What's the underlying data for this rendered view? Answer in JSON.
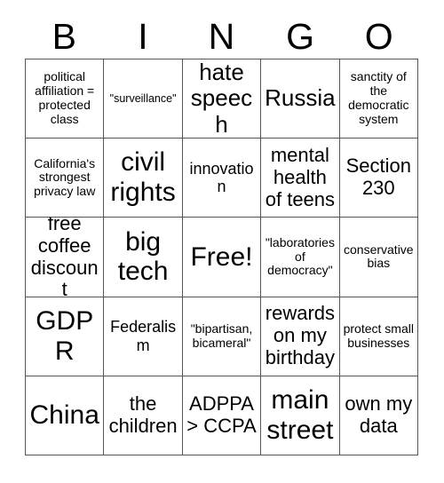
{
  "card": {
    "title_letters": [
      "B",
      "I",
      "N",
      "G",
      "O"
    ],
    "columns": [
      "B",
      "I",
      "N",
      "G",
      "O"
    ],
    "rows": [
      [
        "political affiliation = protected class",
        "\"surveillance\"",
        "hate speech",
        "Russia",
        "sanctity of the democratic system"
      ],
      [
        "California's strongest privacy law",
        "civil rights",
        "innovation",
        "mental health of teens",
        "Section 230"
      ],
      [
        "free coffee discount",
        "big tech",
        "Free!",
        "\"laboratories of democracy\"",
        "conservative bias"
      ],
      [
        "GDPR",
        "Federalism",
        "\"bipartisan, bicameral\"",
        "rewards on my birthday",
        "protect small businesses"
      ],
      [
        "China",
        "the children",
        "ADPPA > CCPA",
        "main street",
        "own my data"
      ]
    ],
    "free_space": "Free!",
    "colors": {
      "background": "#ffffff",
      "text": "#000000",
      "grid_line": "#555555"
    }
  }
}
